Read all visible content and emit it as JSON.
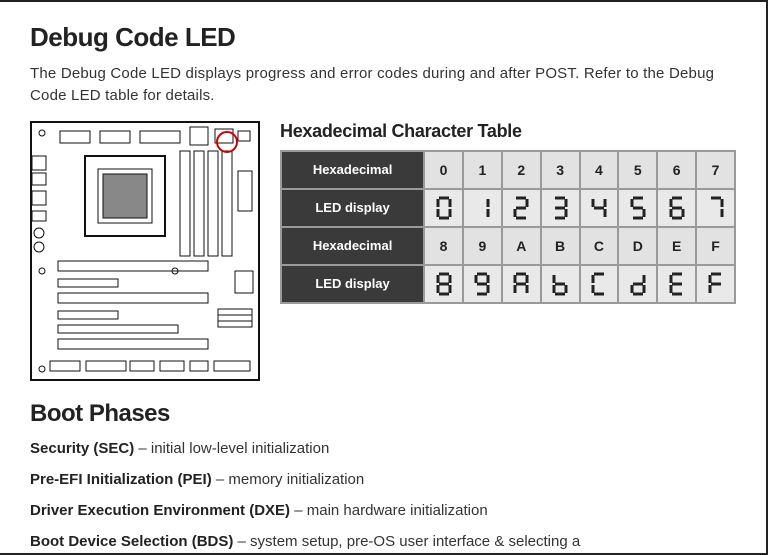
{
  "heading": "Debug Code LED",
  "intro": "The Debug Code LED displays progress and error codes during and after POST. Refer to the Debug Code LED table for details.",
  "tableTitle": "Hexadecimal Character Table",
  "labels": {
    "hex": "Hexadecimal",
    "led": "LED display"
  },
  "row1hex": [
    "0",
    "1",
    "2",
    "3",
    "4",
    "5",
    "6",
    "7"
  ],
  "row2hex": [
    "8",
    "9",
    "A",
    "B",
    "C",
    "D",
    "E",
    "F"
  ],
  "bootHeading": "Boot Phases",
  "phases": [
    {
      "b": "Security (SEC)",
      "t": " – initial low-level initialization"
    },
    {
      "b": "Pre-EFI Initialization (PEI)",
      "t": " – memory initialization"
    },
    {
      "b": "Driver Execution Environment (DXE)",
      "t": " – main hardware initialization"
    },
    {
      "b": "Boot Device Selection (BDS)",
      "t": " – system setup, pre-OS user interface & selecting a"
    }
  ]
}
